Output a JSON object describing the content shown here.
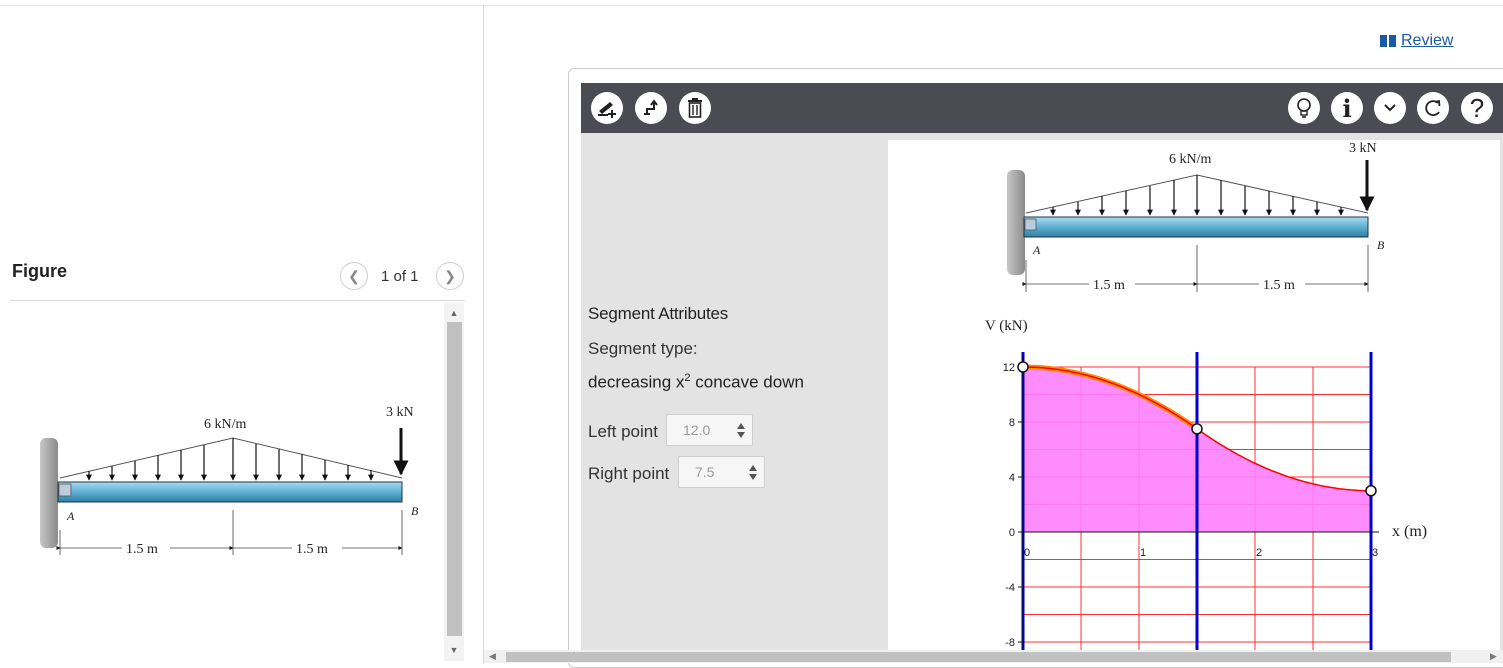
{
  "review": {
    "label": "Review"
  },
  "figure": {
    "title": "Figure",
    "page_indicator": "1 of 1",
    "beam": {
      "load_label": "6 kN/m",
      "point_load_label": "3 kN",
      "support_a": "A",
      "end_b": "B",
      "dim_left": "1.5 m",
      "dim_right": "1.5 m"
    }
  },
  "toolbar": {
    "left_icons": [
      "add-segment-icon",
      "step-icon",
      "trash-icon"
    ],
    "right_icons": [
      "lightbulb-icon",
      "info-icon",
      "chevron-down-icon",
      "redo-icon",
      "help-icon"
    ]
  },
  "segment_attributes": {
    "title": "Segment Attributes",
    "type_label": "Segment type:",
    "type_value_prefix": "decreasing x",
    "type_value_sup": "2",
    "type_value_suffix": " concave down",
    "left_point_label": "Left point",
    "left_point_value": "12.0",
    "right_point_label": "Right point",
    "right_point_value": "7.5"
  },
  "canvas_diagram": {
    "load_label": "6 kN/m",
    "point_load_label": "3 kN",
    "support_a": "A",
    "end_b": "B",
    "dim_left": "1.5 m",
    "dim_right": "1.5 m",
    "y_axis_label": "V (kN)",
    "x_axis_label": "x (m)"
  },
  "chart_data": {
    "type": "line",
    "title": "",
    "ylabel": "V (kN)",
    "xlabel": "x (m)",
    "xlim": [
      0,
      3
    ],
    "ylim": [
      -8,
      12
    ],
    "x_ticks": [
      "0",
      "1",
      "2",
      "3"
    ],
    "y_ticks": [
      "12",
      "8",
      "4",
      "0",
      "-4",
      "-8"
    ],
    "grid": true,
    "colors": {
      "fill": "#ff80ff",
      "curve": "#ff0000",
      "selected_segment": "#ff8c00",
      "verticals": "#0000cc",
      "grid": "#ff3030"
    },
    "vertical_lines_x": [
      0,
      1.5,
      3
    ],
    "points": [
      {
        "x": 0,
        "y": 12
      },
      {
        "x": 1.5,
        "y": 7.5
      },
      {
        "x": 3,
        "y": 3
      }
    ],
    "segments": [
      {
        "x_start": 0,
        "x_end": 1.5,
        "y_start": 12,
        "y_end": 7.5,
        "shape": "decreasing x^2 concave down",
        "selected": true
      },
      {
        "x_start": 1.5,
        "x_end": 3,
        "y_start": 7.5,
        "y_end": 3,
        "shape": "decreasing concave up",
        "selected": false
      }
    ]
  }
}
